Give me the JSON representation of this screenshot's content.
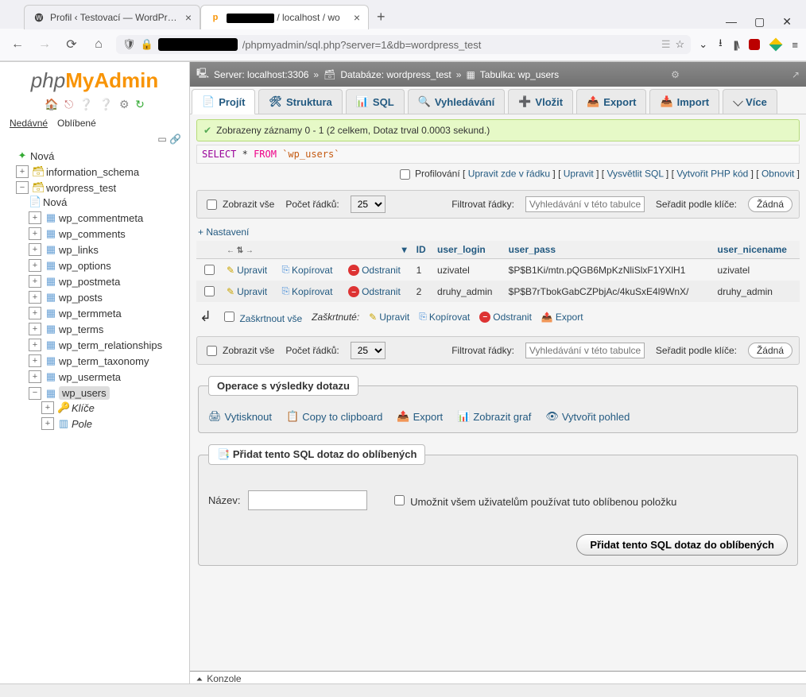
{
  "browser": {
    "tab1_title": "Profil ‹ Testovací — WordPress",
    "tab2_title": "/ localhost / wo",
    "url_suffix": "/phpmyadmin/sql.php?server=1&db=wordpress_test"
  },
  "logo": {
    "part1": "php",
    "part2": "My",
    "part3": "Admin"
  },
  "sidebar": {
    "recent": "Nedávné",
    "fav": "Oblíbené",
    "new": "Nová",
    "db1": "information_schema",
    "db2": "wordpress_test",
    "db2_new": "Nová",
    "tables": [
      "wp_commentmeta",
      "wp_comments",
      "wp_links",
      "wp_options",
      "wp_postmeta",
      "wp_posts",
      "wp_termmeta",
      "wp_terms",
      "wp_term_relationships",
      "wp_term_taxonomy",
      "wp_usermeta"
    ],
    "selected_table": "wp_users",
    "sub_keys": "Klíče",
    "sub_cols": "Pole"
  },
  "breadcrumb": {
    "server": "Server: localhost:3306",
    "db": "Databáze: wordpress_test",
    "tbl": "Tabulka: wp_users"
  },
  "menu": {
    "browse": "Projít",
    "structure": "Struktura",
    "sql": "SQL",
    "search": "Vyhledávání",
    "insert": "Vložit",
    "export": "Export",
    "import": "Import",
    "more": "Více"
  },
  "success_msg": "Zobrazeny záznamy 0 - 1 (2 celkem, Dotaz trval 0.0003 sekund.)",
  "sql": {
    "select": "SELECT",
    "star": "*",
    "from": "FROM",
    "table": "`wp_users`"
  },
  "links": {
    "profiling": "Profilování",
    "edit_inline": "Upravit zde v řádku",
    "edit": "Upravit",
    "explain": "Vysvětlit SQL",
    "php": "Vytvořit PHP kód",
    "refresh": "Obnovit"
  },
  "toolbar": {
    "showall": "Zobrazit vše",
    "rowcount_label": "Počet řádků:",
    "rowcount_value": "25",
    "filter_label": "Filtrovat řádky:",
    "filter_placeholder": "Vyhledávání v této tabulce",
    "sort_label": "Seřadit podle klíče:",
    "sort_value": "Žádná"
  },
  "settings_link": "+ Nastavení",
  "cols": {
    "id": "ID",
    "login": "user_login",
    "pass": "user_pass",
    "nice": "user_nicename"
  },
  "rows": [
    {
      "id": "1",
      "login": "uzivatel",
      "pass": "$P$B1Ki/mtn.pQGB6MpKzNliSlxF1YXlH1",
      "nice": "uzivatel"
    },
    {
      "id": "2",
      "login": "druhy_admin",
      "pass": "$P$B7rTbokGabCZPbjAc/4kuSxE4l9WnX/",
      "nice": "druhy_admin"
    }
  ],
  "rowactions": {
    "edit": "Upravit",
    "copy": "Kopírovat",
    "delete": "Odstranit"
  },
  "checkall": {
    "label": "Zaškrtnout vše",
    "withsel": "Zaškrtnuté:",
    "edit": "Upravit",
    "copy": "Kopírovat",
    "delete": "Odstranit",
    "export": "Export"
  },
  "ops": {
    "legend": "Operace s výsledky dotazu",
    "print": "Vytisknout",
    "clip": "Copy to clipboard",
    "export": "Export",
    "chart": "Zobrazit graf",
    "view": "Vytvořit pohled"
  },
  "fav": {
    "legend": "Přidat tento SQL dotaz do oblíbených",
    "name_label": "Název:",
    "allow": "Umožnit všem uživatelům používat tuto oblíbenou položku",
    "button": "Přidat tento SQL dotaz do oblíbených"
  },
  "console": "Konzole"
}
